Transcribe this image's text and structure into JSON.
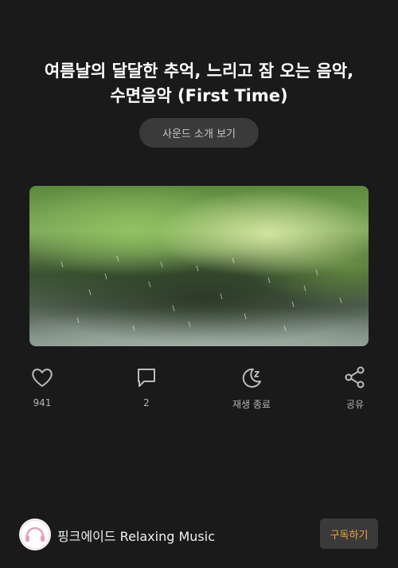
{
  "video": {
    "title_line1": "여름날의 달달한 추억, 느리고 잠 오는 음악,",
    "title_line2": "수면음악 (First Time)",
    "sound_intro_label": "사운드 소개 보기"
  },
  "actions": {
    "like_count": "941",
    "comment_count": "2",
    "sleep_label": "재생 종료",
    "share_label": "공유"
  },
  "channel": {
    "name": "핑크에이드 Relaxing Music",
    "subscribe_label": "구독하기"
  },
  "colors": {
    "background": "#1a1a1a",
    "button_bg": "#3a3a3a",
    "subscribe_accent": "#f0a23b",
    "avatar_pink": "#e7a1b6"
  }
}
